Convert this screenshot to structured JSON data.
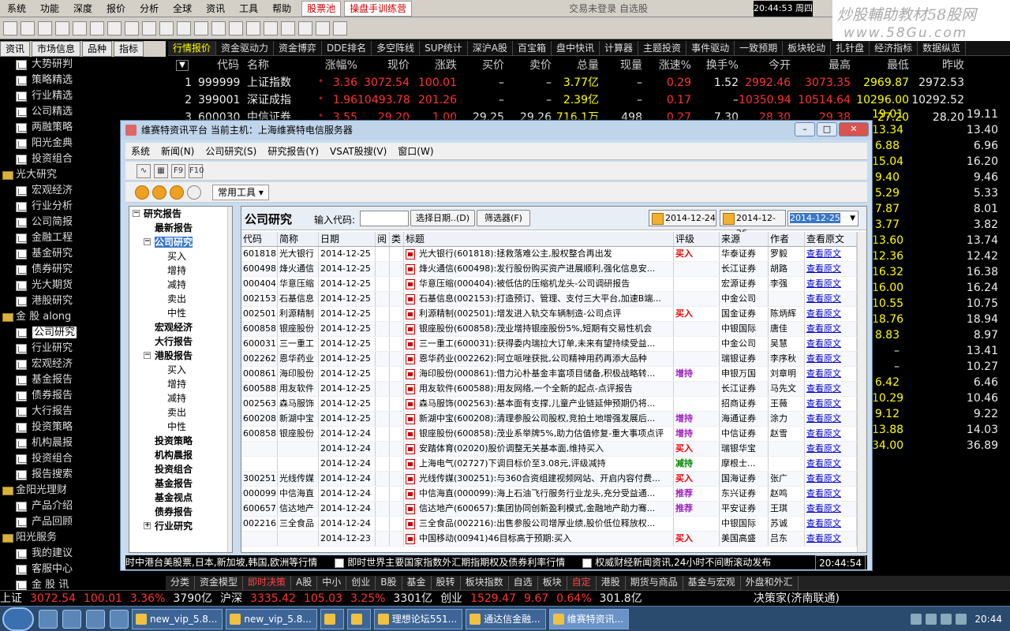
{
  "menubar": {
    "items": [
      "系统",
      "功能",
      "深度",
      "报价",
      "分析",
      "全球",
      "资讯",
      "工具",
      "帮助"
    ],
    "hl1": "股票池",
    "hl2": "操盘手训练营",
    "center_text": "交易未登录   自选股",
    "clock": "20:44:53 周四",
    "after_clock": "行"
  },
  "watermark": {
    "line1": "炒股輔助教材58股网",
    "line2": "www.58Gu.com"
  },
  "left_tabs": [
    "资讯",
    "市场信息",
    "品种",
    "指标"
  ],
  "market_tabs": [
    "行情报价",
    "资金驱动力",
    "资金博弈",
    "DDE排名",
    "多空阵线",
    "SUP统计",
    "深沪A股",
    "百宝箱",
    "盘中快讯",
    "计算器",
    "主题投资",
    "事件驱动",
    "一致预期",
    "板块轮动",
    "扎针盘",
    "经济指标",
    "数据纵览"
  ],
  "sidebar": [
    {
      "t": "大势研判",
      "k": "child"
    },
    {
      "t": "策略精选",
      "k": "child"
    },
    {
      "t": "行业精选",
      "k": "child"
    },
    {
      "t": "公司精选",
      "k": "child"
    },
    {
      "t": "两融策略",
      "k": "child"
    },
    {
      "t": "阳光金典",
      "k": "child"
    },
    {
      "t": "投资组合",
      "k": "child"
    },
    {
      "t": "光大研究",
      "k": "folder"
    },
    {
      "t": "宏观经济",
      "k": "child"
    },
    {
      "t": "行业分析",
      "k": "child"
    },
    {
      "t": "公司简报",
      "k": "child"
    },
    {
      "t": "金融工程",
      "k": "child"
    },
    {
      "t": "基金研究",
      "k": "child"
    },
    {
      "t": "债券研究",
      "k": "child"
    },
    {
      "t": "光大期货",
      "k": "child"
    },
    {
      "t": "港股研究",
      "k": "child"
    },
    {
      "t": "金 股 along",
      "k": "folder"
    },
    {
      "t": "公司研究",
      "k": "child",
      "sel": true
    },
    {
      "t": "行业研究",
      "k": "child"
    },
    {
      "t": "宏观经济",
      "k": "child"
    },
    {
      "t": "基金报告",
      "k": "child"
    },
    {
      "t": "债券报告",
      "k": "child"
    },
    {
      "t": "大行报告",
      "k": "child"
    },
    {
      "t": "投资策略",
      "k": "child"
    },
    {
      "t": "机构晨报",
      "k": "child"
    },
    {
      "t": "投资组合",
      "k": "child"
    },
    {
      "t": "报告搜索",
      "k": "child"
    },
    {
      "t": "金阳光理财",
      "k": "folder"
    },
    {
      "t": "产品介绍",
      "k": "child"
    },
    {
      "t": "产品回顾",
      "k": "child"
    },
    {
      "t": "阳光服务",
      "k": "folder"
    },
    {
      "t": "我的建议",
      "k": "child"
    },
    {
      "t": "客服中心",
      "k": "child"
    },
    {
      "t": "金 股 讯",
      "k": "child"
    }
  ],
  "quote_headers": [
    "代码",
    "名称",
    "涨幅%",
    "现价",
    "涨跌",
    "买价",
    "卖价",
    "总量",
    "现量",
    "涨速%",
    "换手%",
    "今开",
    "最高",
    "最低",
    "昨收"
  ],
  "quotes": [
    {
      "n": "1",
      "code": "999999",
      "name": "上证指数",
      "chg": "3.36",
      "price": "3072.54",
      "diff": "100.01",
      "buy": "–",
      "sell": "–",
      "vol": "3.77亿",
      "cur": "–",
      "spd": "0.29",
      "turn": "1.52",
      "open": "2992.46",
      "high": "3073.35",
      "low": "2969.87",
      "prev": "2972.53"
    },
    {
      "n": "2",
      "code": "399001",
      "name": "深证成指",
      "chg": "1.96",
      "price": "10493.78",
      "diff": "201.26",
      "buy": "–",
      "sell": "–",
      "vol": "2.39亿",
      "cur": "–",
      "spd": "0.17",
      "turn": "–",
      "open": "10350.94",
      "high": "10514.64",
      "low": "10296.00",
      "prev": "10292.52"
    },
    {
      "n": "3",
      "code": "600030",
      "name": "中信证券",
      "chg": "3.55",
      "price": "29.20",
      "diff": "1.00",
      "buy": "29.25",
      "sell": "29.26",
      "vol": "716.1万",
      "cur": "498",
      "spd": "0.27",
      "turn": "7.30",
      "open": "28.30",
      "high": "29.38",
      "low": "27.20",
      "prev": "28.20"
    }
  ],
  "right_col": [
    {
      "low": "19.01",
      "prev": "19.11"
    },
    {
      "low": "13.34",
      "prev": "13.40"
    },
    {
      "low": "6.88",
      "prev": "6.96"
    },
    {
      "low": "15.04",
      "prev": "16.20"
    },
    {
      "low": "9.40",
      "prev": "9.46"
    },
    {
      "low": "5.29",
      "prev": "5.33"
    },
    {
      "low": "7.87",
      "prev": "8.01"
    },
    {
      "low": "3.77",
      "prev": "3.82"
    },
    {
      "low": "13.60",
      "prev": "13.74"
    },
    {
      "low": "12.36",
      "prev": "12.42"
    },
    {
      "low": "16.32",
      "prev": "16.38"
    },
    {
      "low": "16.00",
      "prev": "16.24"
    },
    {
      "low": "10.55",
      "prev": "10.75"
    },
    {
      "low": "18.76",
      "prev": "18.94"
    },
    {
      "low": "8.83",
      "prev": "8.97"
    },
    {
      "low": "–",
      "prev": "13.41"
    },
    {
      "low": "–",
      "prev": "10.27"
    },
    {
      "low": "6.42",
      "prev": "6.46"
    },
    {
      "low": "10.29",
      "prev": "10.46"
    },
    {
      "low": "9.12",
      "prev": "9.22"
    },
    {
      "low": "13.88",
      "prev": "14.03"
    },
    {
      "low": "34.00",
      "prev": "36.89"
    }
  ],
  "bottom_tabs": [
    "分类",
    "资金模型",
    "即时决策",
    "A股",
    "中小",
    "创业",
    "B股",
    "基金",
    "股转",
    "板块指数",
    "自选",
    "板块",
    "自定",
    "港股",
    "期货与商品",
    "基金与宏观",
    "外盘和外汇"
  ],
  "ticker": {
    "sh_label": "上证",
    "sh_price": "3072.54",
    "sh_diff": "100.01",
    "sh_pct": "3.36%",
    "sh_amt": "3790亿",
    "sz_label": "沪深",
    "sz_price": "3335.42",
    "sz_diff": "105.03",
    "sz_pct": "3.25%",
    "sz_amt": "3301亿",
    "cy_label": "创业",
    "cy_price": "1529.47",
    "cy_diff": "9.67",
    "cy_pct": "0.64%",
    "cy_amt": "301.8亿",
    "broker": "决策家(济南联通)"
  },
  "taskbar": {
    "tasks": [
      "new_vip_5.8...",
      "new_vip_5.8...",
      "",
      "",
      "理想论坛551...",
      "通达信金融...",
      "维赛特资讯..."
    ],
    "time": "20:44"
  },
  "dialog": {
    "title": "维赛特资讯平台  当前主机：上海维赛特电信服务器",
    "menu": [
      "系统",
      "新闻(N)",
      "公司研究(S)",
      "研究报告(Y)",
      "VSAT股搜(V)",
      "窗口(W)"
    ],
    "common_tools": "常用工具",
    "tree": [
      {
        "t": "研究报告",
        "lvl": 0,
        "b": true,
        "pm": "−"
      },
      {
        "t": "最新报告",
        "lvl": 1,
        "b": true
      },
      {
        "t": "公司研究",
        "lvl": 1,
        "b": true,
        "pm": "−",
        "sel": true
      },
      {
        "t": "买入",
        "lvl": 2
      },
      {
        "t": "增持",
        "lvl": 2
      },
      {
        "t": "减持",
        "lvl": 2
      },
      {
        "t": "卖出",
        "lvl": 2
      },
      {
        "t": "中性",
        "lvl": 2
      },
      {
        "t": "宏观经济",
        "lvl": 1,
        "b": true
      },
      {
        "t": "大行报告",
        "lvl": 1,
        "b": true
      },
      {
        "t": "港股报告",
        "lvl": 1,
        "b": true,
        "pm": "−"
      },
      {
        "t": "买入",
        "lvl": 2
      },
      {
        "t": "增持",
        "lvl": 2
      },
      {
        "t": "减持",
        "lvl": 2
      },
      {
        "t": "卖出",
        "lvl": 2
      },
      {
        "t": "中性",
        "lvl": 2
      },
      {
        "t": "投资策略",
        "lvl": 1,
        "b": true
      },
      {
        "t": "机构晨报",
        "lvl": 1,
        "b": true
      },
      {
        "t": "投资组合",
        "lvl": 1,
        "b": true
      },
      {
        "t": "基金报告",
        "lvl": 1,
        "b": true
      },
      {
        "t": "基金视点",
        "lvl": 1,
        "b": true
      },
      {
        "t": "债券报告",
        "lvl": 1,
        "b": true
      },
      {
        "t": "行业研究",
        "lvl": 1,
        "b": true,
        "pm": "+"
      }
    ],
    "content_title": "公司研究",
    "code_label": "输入代码:",
    "select_date_btn": "选择日期..(D)",
    "filter_btn": "筛选器(F)",
    "date1": "2014-12-24",
    "date2": "2014-12-26",
    "date_select": "2014-12-25",
    "table_headers": [
      "代码",
      "简称",
      "日期",
      "阅",
      "类",
      "标题",
      "评级",
      "来源",
      "作者",
      "查看原文"
    ],
    "rows": [
      {
        "code": "601818",
        "name": "光大银行",
        "date": "2014-12-25",
        "title": "光大银行(601818):拯救落难公主,股权整合再出发",
        "rating": "买入",
        "rc": "red",
        "src": "华泰证券",
        "author": "罗毅"
      },
      {
        "code": "600498",
        "name": "烽火通信",
        "date": "2014-12-25",
        "title": "烽火通信(600498):发行股份购买资产进展顺利,强化信息安...",
        "rating": "",
        "rc": "",
        "src": "长江证券",
        "author": "胡路"
      },
      {
        "code": "000404",
        "name": "华意压缩",
        "date": "2014-12-25",
        "title": "华意压缩(000404):被低估的压缩机龙头-公司调研报告",
        "rating": "",
        "rc": "",
        "src": "宏源证券",
        "author": "李强"
      },
      {
        "code": "002153",
        "name": "石基信息",
        "date": "2014-12-25",
        "title": "石基信息(002153):打造预订、管理、支付三大平台,加速B端...",
        "rating": "",
        "rc": "",
        "src": "中金公司",
        "author": ""
      },
      {
        "code": "002501",
        "name": "利源精制",
        "date": "2014-12-25",
        "title": "利源精制(002501):增发进入轨交车辆制造-公司点评",
        "rating": "买入",
        "rc": "red",
        "src": "国金证券",
        "author": "陈炳辉"
      },
      {
        "code": "600858",
        "name": "银座股份",
        "date": "2014-12-25",
        "title": "银座股份(600858):茂业增持银座股份5%,短期有交易性机会",
        "rating": "",
        "rc": "",
        "src": "中银国际",
        "author": "唐佳"
      },
      {
        "code": "600031",
        "name": "三一重工",
        "date": "2014-12-25",
        "title": "三一重工(600031):获得委内瑞拉大订单,未来有望持续受益...",
        "rating": "",
        "rc": "",
        "src": "中金公司",
        "author": "吴慧"
      },
      {
        "code": "002262",
        "name": "恩华药业",
        "date": "2014-12-25",
        "title": "恩华药业(002262):阿立哌唑获批,公司精神用药再添大品种",
        "rating": "",
        "rc": "",
        "src": "瑞银证券",
        "author": "李序秋"
      },
      {
        "code": "000861",
        "name": "海印股份",
        "date": "2014-12-25",
        "title": "海印股份(000861):借力沁朴基金丰富项目储备,积极战略转...",
        "rating": "增持",
        "rc": "purple",
        "src": "申银万国",
        "author": "刘章明"
      },
      {
        "code": "600588",
        "name": "用友软件",
        "date": "2014-12-25",
        "title": "用友软件(600588):用友网络,一个全新的起点-点评报告",
        "rating": "",
        "rc": "",
        "src": "长江证券",
        "author": "马先文"
      },
      {
        "code": "002563",
        "name": "森马服饰",
        "date": "2014-12-25",
        "title": "森马服饰(002563):基本面有支撑,儿童产业链延伸预期仍将...",
        "rating": "",
        "rc": "",
        "src": "招商证券",
        "author": "王薇"
      },
      {
        "code": "600208",
        "name": "新湖中宝",
        "date": "2014-12-25",
        "title": "新湖中宝(600208):清理参股公司股权,竞拍土地增强发展后...",
        "rating": "增持",
        "rc": "purple",
        "src": "海通证券",
        "author": "涂力"
      },
      {
        "code": "600858",
        "name": "银座股份",
        "date": "2014-12-24",
        "title": "银座股份(600858):茂业系举牌5%,助力估值修复-重大事项点评",
        "rating": "增持",
        "rc": "purple",
        "src": "中信证券",
        "author": "赵雪"
      },
      {
        "code": "",
        "name": "",
        "date": "2014-12-24",
        "title": "安踏体育(02020)股价调整无关基本面,维持买入",
        "rating": "买入",
        "rc": "red",
        "src": "瑞银华宝",
        "author": ""
      },
      {
        "code": "",
        "name": "",
        "date": "2014-12-24",
        "title": "上海电气(02727)下调目标价至3.08元,评级减持",
        "rating": "减持",
        "rc": "green",
        "src": "摩根士...",
        "author": ""
      },
      {
        "code": "300251",
        "name": "光线传媒",
        "date": "2014-12-24",
        "title": "光线传媒(300251):与360合资组建视频网站、开启内容付费...",
        "rating": "买入",
        "rc": "red",
        "src": "国海证券",
        "author": "张广"
      },
      {
        "code": "000099",
        "name": "中信海直",
        "date": "2014-12-24",
        "title": "中信海直(000099):海上石油飞行服务行业龙头,充分受益通...",
        "rating": "推荐",
        "rc": "purple",
        "src": "东兴证券",
        "author": "赵鸣"
      },
      {
        "code": "600657",
        "name": "信达地产",
        "date": "2014-12-24",
        "title": "信达地产(600657):集团协同创新盈利模式,金融地产助力骞...",
        "rating": "推荐",
        "rc": "purple",
        "src": "平安证券",
        "author": "王琪"
      },
      {
        "code": "002216",
        "name": "三全食品",
        "date": "2014-12-24",
        "title": "三全食品(002216):出售参股公司增厚业绩,股价低位释放权...",
        "rating": "",
        "rc": "",
        "src": "中银国际",
        "author": "苏诚"
      },
      {
        "code": "",
        "name": "",
        "date": "2014-12-23",
        "title": "中国移动(00941)46目标高于预期:买入",
        "rating": "买入",
        "rc": "red",
        "src": "美国高盛",
        "author": "吕东"
      }
    ],
    "view_link": "查看原文",
    "status_items": [
      "时中港台美股票,日本,新加坡,韩国,欧洲等行情",
      "即时世界主要国家指数外汇期指期权及债券利率行情",
      "权威财经新闻资讯,24小时不间断滚动发布"
    ],
    "status_clock": "20:44:54"
  }
}
